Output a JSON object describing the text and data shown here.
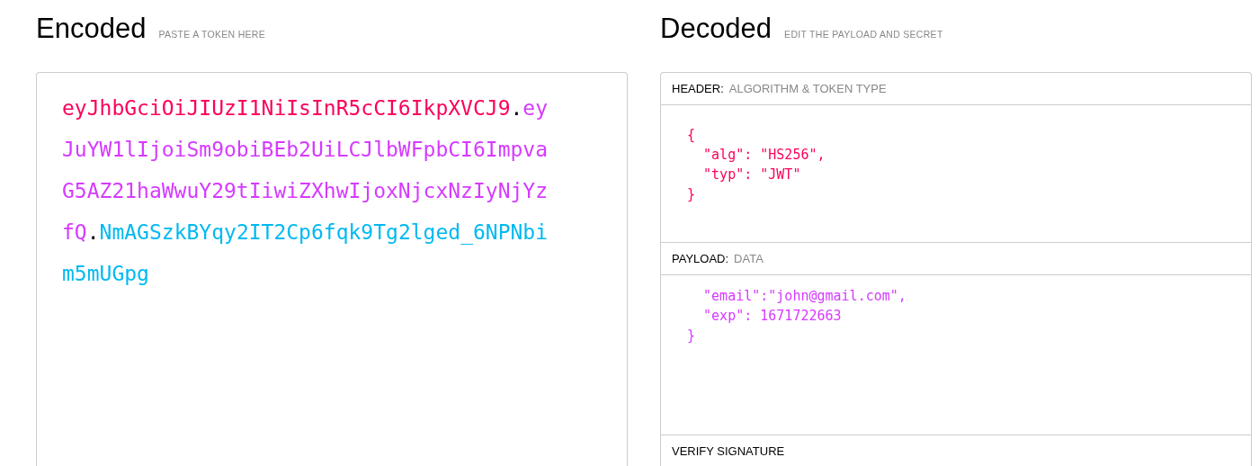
{
  "encoded": {
    "title": "Encoded",
    "subtitle": "PASTE A TOKEN HERE",
    "token": [
      {
        "text": "eyJhbGciOiJIUzI1NiIsInR5cCI6IkpXVCJ9",
        "color": "#fb015b"
      },
      {
        "text": ".",
        "color": "#000000"
      },
      {
        "text": "eyJuYW1lIjoiSm9obiBEb2UiLCJlbWFpbCI6ImpvaG5AZ21haWwuY29tIiwiZXhwIjoxNjcxNzIyNjYzfQ",
        "color": "#d63aff"
      },
      {
        "text": ".",
        "color": "#000000"
      },
      {
        "text": "NmAGSzkBYqy2IT2Cp6fqk9Tg2lged_6NPNbim5mUGpg",
        "color": "#00b9f1"
      }
    ]
  },
  "decoded": {
    "title": "Decoded",
    "subtitle": "EDIT THE PAYLOAD AND SECRET",
    "sections": [
      {
        "label": "HEADER:",
        "hint": "ALGORITHM & TOKEN TYPE",
        "color": "#fb015b",
        "lines": [
          "{",
          "  \"alg\": \"HS256\",",
          "  \"typ\": \"JWT\"",
          "}"
        ]
      },
      {
        "label": "PAYLOAD:",
        "hint": "DATA",
        "color": "#d63aff",
        "lines": [
          "  \"email\":\"john@gmail.com\",",
          "  \"exp\": 1671722663",
          "}"
        ]
      },
      {
        "label": "VERIFY SIGNATURE"
      }
    ]
  }
}
